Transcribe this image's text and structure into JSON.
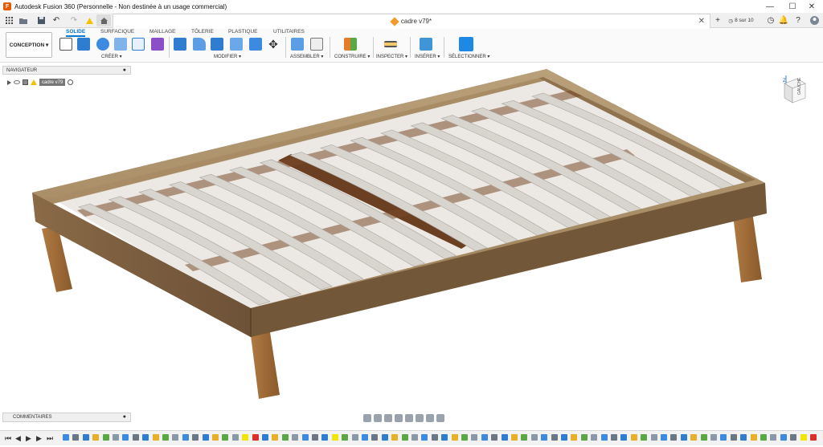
{
  "window": {
    "title": "Autodesk Fusion 360 (Personnelle - Non destinée à un usage commercial)",
    "app_icon": "fusion-logo-icon",
    "minimize": "—",
    "maximize": "☐",
    "close": "✕"
  },
  "tabbar": {
    "doc_tab_label": "cadre v79*",
    "doc_tab_close": "✕",
    "new_tab": "+",
    "job_status": "8 sur 10",
    "icons": [
      "grid-icon",
      "save-icon",
      "undo-icon",
      "redo-icon",
      "warning-icon",
      "home-icon",
      "clock-icon",
      "bell-icon",
      "help-icon",
      "user-avatar-icon"
    ]
  },
  "ribbon": {
    "workspace": "CONCEPTION ▾",
    "tabs": [
      "SOLIDE",
      "SURFACIQUE",
      "MAILLAGE",
      "TÔLERIE",
      "PLASTIQUE",
      "UTILITAIRES"
    ],
    "active_tab": "SOLIDE",
    "groups": [
      "CRÉER ▾",
      "MODIFIER ▾",
      "ASSEMBLER ▾",
      "CONSTRUIRE ▾",
      "INSPECTER ▾",
      "INSÉRER ▾",
      "SÉLECTIONNER ▾"
    ]
  },
  "browser": {
    "navigator_title": "NAVIGATEUR",
    "component_label": "cadre v79",
    "comments_title": "COMMENTAIRES"
  },
  "viewcube": {
    "face_label": "GAUCHE",
    "axis": "Z"
  },
  "colors": {
    "accent": "#0078d4",
    "wood_frame": "#7a5a3a",
    "wood_legs": "#9a6a3a",
    "slats": "#d8d5cf",
    "inner_beams": "#6b3f22"
  }
}
